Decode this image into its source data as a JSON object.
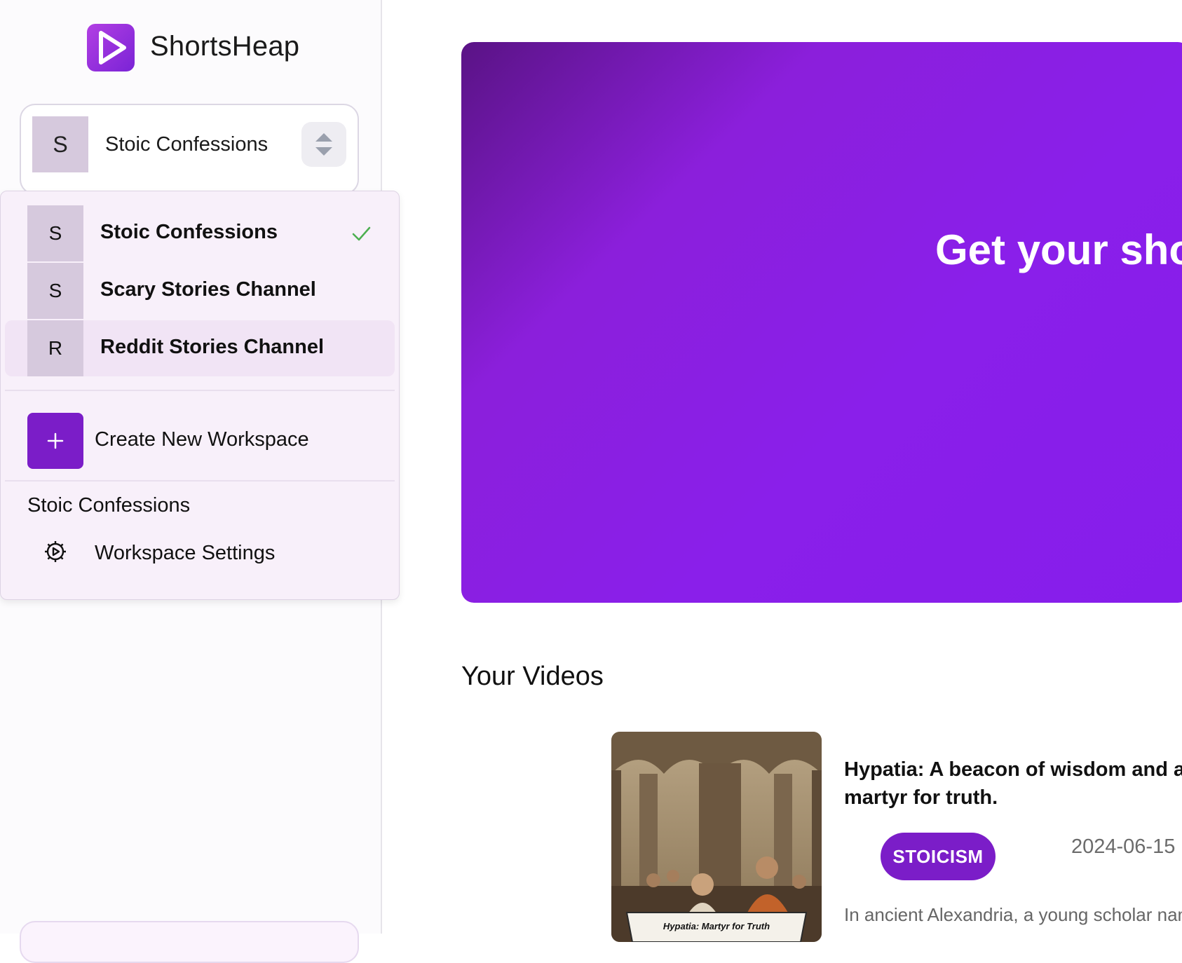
{
  "app": {
    "title": "ShortsHeap"
  },
  "workspace_selector": {
    "avatar": "S",
    "name": "Stoic Confessions"
  },
  "dropdown": {
    "workspaces": [
      {
        "avatar": "S",
        "name": "Stoic Confessions",
        "selected": true
      },
      {
        "avatar": "S",
        "name": "Scary Stories Channel",
        "selected": false
      },
      {
        "avatar": "R",
        "name": "Reddit Stories Channel",
        "selected": false
      }
    ],
    "create_label": "Create New Workspace",
    "section_label": "Stoic Confessions",
    "settings_label": "Workspace Settings"
  },
  "hero": {
    "title": "Get your sho"
  },
  "videos": {
    "heading": "Your Videos",
    "items": [
      {
        "thumbnail_caption": "Hypatia: Martyr for Truth",
        "title": "Hypatia: A beacon of wisdom and a martyr for truth.",
        "tag": "STOICISM",
        "date": "2024-06-15",
        "description": "In ancient Alexandria, a young scholar nam"
      }
    ]
  },
  "colors": {
    "accent": "#7b1dc8",
    "hero_start": "#5a1385",
    "hero_end": "#861deb",
    "check": "#4caf50"
  },
  "icons": [
    "play-logo-icon",
    "chevron-up-down-icon",
    "check-icon",
    "plus-icon",
    "gear-icon"
  ]
}
